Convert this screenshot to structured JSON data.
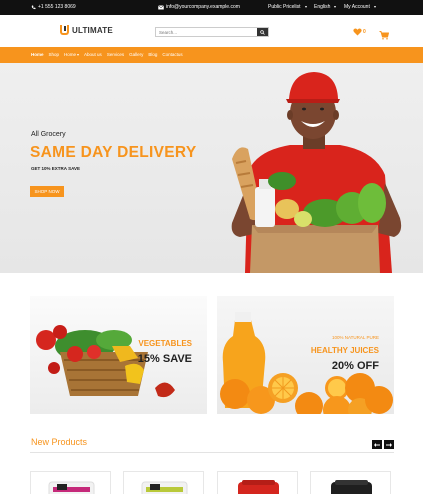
{
  "topbar": {
    "phone": "+1 555 123 8069",
    "email": "info@yourcompany.example.com",
    "pricelist": "Public Pricelist",
    "language": "English",
    "account": "My Account"
  },
  "header": {
    "logo_text": "ULTIMATE",
    "search_placeholder": "Search...",
    "wishlist_count": "0",
    "cart_count": ""
  },
  "nav": {
    "items": [
      {
        "label": "Home",
        "active": true
      },
      {
        "label": "Shop"
      },
      {
        "label": "Home"
      },
      {
        "label": "About us"
      },
      {
        "label": "Services"
      },
      {
        "label": "Gallery"
      },
      {
        "label": "Blog"
      },
      {
        "label": "Contactus"
      }
    ]
  },
  "hero": {
    "pre_title": "All Grocery",
    "title": "SAME DAY DELIVERY",
    "subtitle": "GET 10% EXTRA SAVE",
    "button": "SHOP NOW"
  },
  "promos": [
    {
      "tag": "VEGETABLES",
      "big": "15% SAVE"
    },
    {
      "small": "100% NATURAL PURE",
      "tag": "HEALTHY JUICES",
      "big": "20% OFF"
    }
  ],
  "new_products": {
    "title": "New Products"
  },
  "colors": {
    "accent": "#f7941d",
    "topbar": "#111111",
    "hero_bg": "#ececec"
  }
}
